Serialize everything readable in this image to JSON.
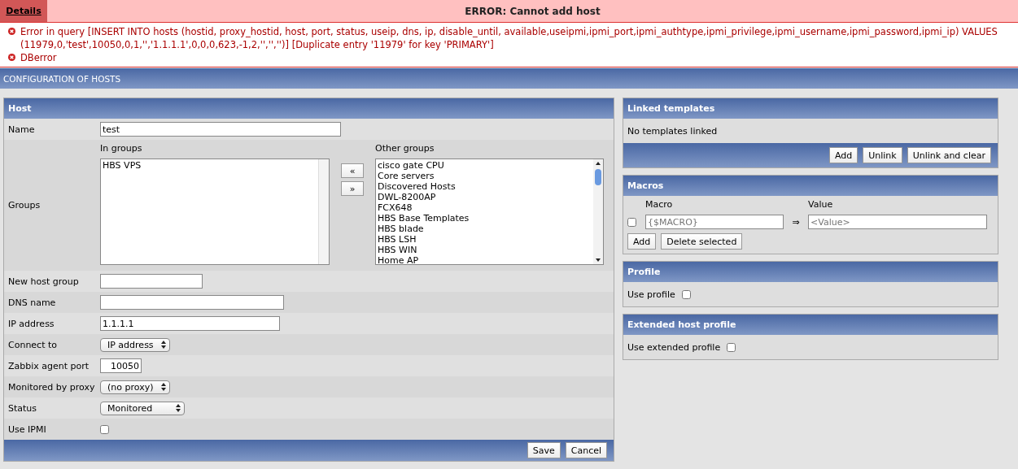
{
  "error": {
    "details_link": "Details",
    "title": "ERROR: Cannot add host",
    "messages": [
      "Error in query [INSERT INTO hosts (hostid, proxy_hostid, host, port, status, useip, dns, ip, disable_until, available,useipmi,ipmi_port,ipmi_authtype,ipmi_privilege,ipmi_username,ipmi_password,ipmi_ip) VALUES (11979,0,'test',10050,0,1,'','1.1.1.1',0,0,0,623,-1,2,'','','')] [Duplicate entry '11979' for key 'PRIMARY']",
      "DBerror"
    ]
  },
  "page_title": "CONFIGURATION OF HOSTS",
  "host_form": {
    "title": "Host",
    "rows": [
      {
        "kind": "text",
        "label": "Name",
        "value": "test"
      },
      {
        "kind": "groups",
        "label": "Groups",
        "in_groups_label": "In groups",
        "in_groups": [
          "HBS VPS"
        ],
        "move_buttons": [
          "«",
          "»"
        ],
        "other_groups_label": "Other groups",
        "other_groups": [
          "cisco gate CPU",
          "Core servers",
          "Discovered Hosts",
          "DWL-8200AP",
          "FCX648",
          "HBS Base Templates",
          "HBS blade",
          "HBS LSH",
          "HBS WIN",
          "Home AP"
        ]
      },
      {
        "kind": "text",
        "label": "New host group",
        "value": ""
      },
      {
        "kind": "text",
        "label": "DNS name",
        "value": ""
      },
      {
        "kind": "text",
        "label": "IP address",
        "value": "1.1.1.1"
      },
      {
        "kind": "select",
        "label": "Connect to",
        "value": "IP address"
      },
      {
        "kind": "text",
        "label": "Zabbix agent port",
        "value": "10050"
      },
      {
        "kind": "select",
        "label": "Monitored by proxy",
        "value": "(no proxy)"
      },
      {
        "kind": "select",
        "label": "Status",
        "value": "Monitored"
      },
      {
        "kind": "checkbox",
        "label": "Use IPMI",
        "checked": false
      }
    ],
    "buttons": [
      "Save",
      "Cancel"
    ]
  },
  "linked_templates": {
    "title": "Linked templates",
    "message": "No templates linked",
    "buttons": [
      "Add",
      "Unlink",
      "Unlink and clear"
    ]
  },
  "macros": {
    "title": "Macros",
    "columns": [
      "Macro",
      "Value"
    ],
    "rows": [
      {
        "checked": false,
        "macro_placeholder": "{$MACRO}",
        "arrow": "⇒",
        "value_placeholder": "<Value>"
      }
    ],
    "buttons": [
      "Add",
      "Delete selected"
    ]
  },
  "profile": {
    "title": "Profile",
    "label": "Use profile",
    "checked": false
  },
  "extended_profile": {
    "title": "Extended host profile",
    "label": "Use extended profile",
    "checked": false
  }
}
